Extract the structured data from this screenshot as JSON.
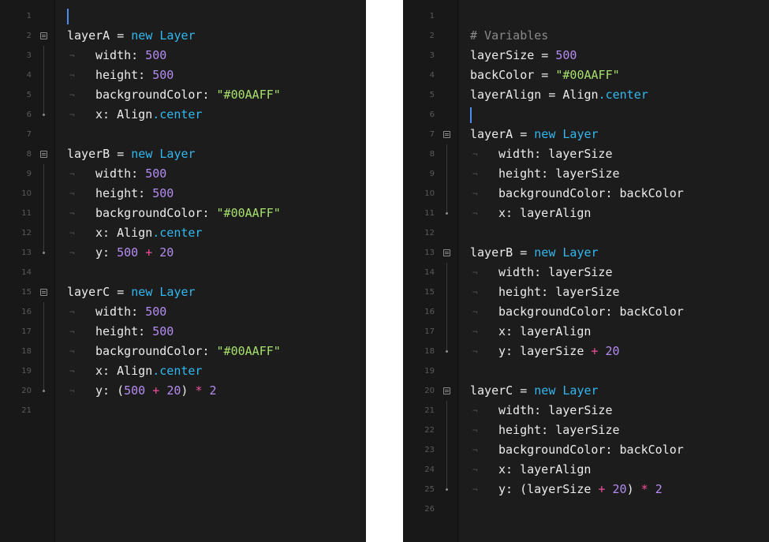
{
  "colors": {
    "keyword": "#32b8f0",
    "number": "#b48cf2",
    "string": "#a6e06c",
    "operator": "#f0509a",
    "comment": "#8a8a8a",
    "text": "#ececec",
    "background": "#1c1c1c",
    "gutter": "#181818",
    "cursor": "#4e8cf0"
  },
  "icons": {
    "fold": "fold-marker-icon",
    "fold_end": "fold-end-dot-icon",
    "tab_hint": "tab-indent-hint-icon"
  },
  "tab_hint": "¬",
  "left_editor": {
    "lines": [
      {
        "n": "1",
        "cursor": true,
        "tokens": []
      },
      {
        "n": "2",
        "fold": true,
        "tokens": [
          {
            "t": "layerA = ",
            "c": ""
          },
          {
            "t": "new",
            "c": "kw"
          },
          {
            "t": " ",
            "c": ""
          },
          {
            "t": "Layer",
            "c": "cls"
          }
        ]
      },
      {
        "n": "3",
        "foldline": true,
        "indent": true,
        "tokens": [
          {
            "t": "width: ",
            "c": ""
          },
          {
            "t": "500",
            "c": "num"
          }
        ]
      },
      {
        "n": "4",
        "foldline": true,
        "indent": true,
        "tokens": [
          {
            "t": "height: ",
            "c": ""
          },
          {
            "t": "500",
            "c": "num"
          }
        ]
      },
      {
        "n": "5",
        "foldline": true,
        "indent": true,
        "tokens": [
          {
            "t": "backgroundColor: ",
            "c": ""
          },
          {
            "t": "\"#00AAFF\"",
            "c": "str"
          }
        ]
      },
      {
        "n": "6",
        "foldend": true,
        "indent": true,
        "tokens": [
          {
            "t": "x: Align",
            "c": ""
          },
          {
            "t": ".center",
            "c": "prop"
          }
        ]
      },
      {
        "n": "7",
        "tokens": []
      },
      {
        "n": "8",
        "fold": true,
        "tokens": [
          {
            "t": "layerB = ",
            "c": ""
          },
          {
            "t": "new",
            "c": "kw"
          },
          {
            "t": " ",
            "c": ""
          },
          {
            "t": "Layer",
            "c": "cls"
          }
        ]
      },
      {
        "n": "9",
        "foldline": true,
        "indent": true,
        "tokens": [
          {
            "t": "width: ",
            "c": ""
          },
          {
            "t": "500",
            "c": "num"
          }
        ]
      },
      {
        "n": "10",
        "foldline": true,
        "indent": true,
        "tokens": [
          {
            "t": "height: ",
            "c": ""
          },
          {
            "t": "500",
            "c": "num"
          }
        ]
      },
      {
        "n": "11",
        "foldline": true,
        "indent": true,
        "tokens": [
          {
            "t": "backgroundColor: ",
            "c": ""
          },
          {
            "t": "\"#00AAFF\"",
            "c": "str"
          }
        ]
      },
      {
        "n": "12",
        "foldline": true,
        "indent": true,
        "tokens": [
          {
            "t": "x: Align",
            "c": ""
          },
          {
            "t": ".center",
            "c": "prop"
          }
        ]
      },
      {
        "n": "13",
        "foldend": true,
        "indent": true,
        "tokens": [
          {
            "t": "y: ",
            "c": ""
          },
          {
            "t": "500",
            "c": "num"
          },
          {
            "t": " + ",
            "c": "op"
          },
          {
            "t": "20",
            "c": "num"
          }
        ]
      },
      {
        "n": "14",
        "tokens": []
      },
      {
        "n": "15",
        "fold": true,
        "tokens": [
          {
            "t": "layerC = ",
            "c": ""
          },
          {
            "t": "new",
            "c": "kw"
          },
          {
            "t": " ",
            "c": ""
          },
          {
            "t": "Layer",
            "c": "cls"
          }
        ]
      },
      {
        "n": "16",
        "foldline": true,
        "indent": true,
        "tokens": [
          {
            "t": "width: ",
            "c": ""
          },
          {
            "t": "500",
            "c": "num"
          }
        ]
      },
      {
        "n": "17",
        "foldline": true,
        "indent": true,
        "tokens": [
          {
            "t": "height: ",
            "c": ""
          },
          {
            "t": "500",
            "c": "num"
          }
        ]
      },
      {
        "n": "18",
        "foldline": true,
        "indent": true,
        "tokens": [
          {
            "t": "backgroundColor: ",
            "c": ""
          },
          {
            "t": "\"#00AAFF\"",
            "c": "str"
          }
        ]
      },
      {
        "n": "19",
        "foldline": true,
        "indent": true,
        "tokens": [
          {
            "t": "x: Align",
            "c": ""
          },
          {
            "t": ".center",
            "c": "prop"
          }
        ]
      },
      {
        "n": "20",
        "foldend": true,
        "indent": true,
        "tokens": [
          {
            "t": "y: (",
            "c": ""
          },
          {
            "t": "500",
            "c": "num"
          },
          {
            "t": " + ",
            "c": "op"
          },
          {
            "t": "20",
            "c": "num"
          },
          {
            "t": ") ",
            "c": ""
          },
          {
            "t": "*",
            "c": "op"
          },
          {
            "t": " ",
            "c": ""
          },
          {
            "t": "2",
            "c": "num"
          }
        ]
      },
      {
        "n": "21",
        "tokens": []
      }
    ]
  },
  "right_editor": {
    "lines": [
      {
        "n": "1",
        "tokens": []
      },
      {
        "n": "2",
        "tokens": [
          {
            "t": "# Variables",
            "c": "cmt"
          }
        ]
      },
      {
        "n": "3",
        "tokens": [
          {
            "t": "layerSize = ",
            "c": ""
          },
          {
            "t": "500",
            "c": "num"
          }
        ]
      },
      {
        "n": "4",
        "tokens": [
          {
            "t": "backColor = ",
            "c": ""
          },
          {
            "t": "\"#00AAFF\"",
            "c": "str"
          }
        ]
      },
      {
        "n": "5",
        "tokens": [
          {
            "t": "layerAlign = Align",
            "c": ""
          },
          {
            "t": ".center",
            "c": "prop"
          }
        ]
      },
      {
        "n": "6",
        "cursor": true,
        "tokens": []
      },
      {
        "n": "7",
        "fold": true,
        "tokens": [
          {
            "t": "layerA = ",
            "c": ""
          },
          {
            "t": "new",
            "c": "kw"
          },
          {
            "t": " ",
            "c": ""
          },
          {
            "t": "Layer",
            "c": "cls"
          }
        ]
      },
      {
        "n": "8",
        "foldline": true,
        "indent": true,
        "tokens": [
          {
            "t": "width: layerSize",
            "c": ""
          }
        ]
      },
      {
        "n": "9",
        "foldline": true,
        "indent": true,
        "tokens": [
          {
            "t": "height: layerSize",
            "c": ""
          }
        ]
      },
      {
        "n": "10",
        "foldline": true,
        "indent": true,
        "tokens": [
          {
            "t": "backgroundColor: backColor",
            "c": ""
          }
        ]
      },
      {
        "n": "11",
        "foldend": true,
        "indent": true,
        "tokens": [
          {
            "t": "x: layerAlign",
            "c": ""
          }
        ]
      },
      {
        "n": "12",
        "tokens": []
      },
      {
        "n": "13",
        "fold": true,
        "tokens": [
          {
            "t": "layerB = ",
            "c": ""
          },
          {
            "t": "new",
            "c": "kw"
          },
          {
            "t": " ",
            "c": ""
          },
          {
            "t": "Layer",
            "c": "cls"
          }
        ]
      },
      {
        "n": "14",
        "foldline": true,
        "indent": true,
        "tokens": [
          {
            "t": "width: layerSize",
            "c": ""
          }
        ]
      },
      {
        "n": "15",
        "foldline": true,
        "indent": true,
        "tokens": [
          {
            "t": "height: layerSize",
            "c": ""
          }
        ]
      },
      {
        "n": "16",
        "foldline": true,
        "indent": true,
        "tokens": [
          {
            "t": "backgroundColor: backColor",
            "c": ""
          }
        ]
      },
      {
        "n": "17",
        "foldline": true,
        "indent": true,
        "tokens": [
          {
            "t": "x: layerAlign",
            "c": ""
          }
        ]
      },
      {
        "n": "18",
        "foldend": true,
        "indent": true,
        "tokens": [
          {
            "t": "y: layerSize",
            "c": ""
          },
          {
            "t": " + ",
            "c": "op"
          },
          {
            "t": "20",
            "c": "num"
          }
        ]
      },
      {
        "n": "19",
        "tokens": []
      },
      {
        "n": "20",
        "fold": true,
        "tokens": [
          {
            "t": "layerC = ",
            "c": ""
          },
          {
            "t": "new",
            "c": "kw"
          },
          {
            "t": " ",
            "c": ""
          },
          {
            "t": "Layer",
            "c": "cls"
          }
        ]
      },
      {
        "n": "21",
        "foldline": true,
        "indent": true,
        "tokens": [
          {
            "t": "width: layerSize",
            "c": ""
          }
        ]
      },
      {
        "n": "22",
        "foldline": true,
        "indent": true,
        "tokens": [
          {
            "t": "height: layerSize",
            "c": ""
          }
        ]
      },
      {
        "n": "23",
        "foldline": true,
        "indent": true,
        "tokens": [
          {
            "t": "backgroundColor: backColor",
            "c": ""
          }
        ]
      },
      {
        "n": "24",
        "foldline": true,
        "indent": true,
        "tokens": [
          {
            "t": "x: layerAlign",
            "c": ""
          }
        ]
      },
      {
        "n": "25",
        "foldend": true,
        "indent": true,
        "tokens": [
          {
            "t": "y: (layerSize",
            "c": ""
          },
          {
            "t": " + ",
            "c": "op"
          },
          {
            "t": "20",
            "c": "num"
          },
          {
            "t": ") ",
            "c": ""
          },
          {
            "t": "*",
            "c": "op"
          },
          {
            "t": " ",
            "c": ""
          },
          {
            "t": "2",
            "c": "num"
          }
        ]
      },
      {
        "n": "26",
        "tokens": []
      }
    ]
  }
}
